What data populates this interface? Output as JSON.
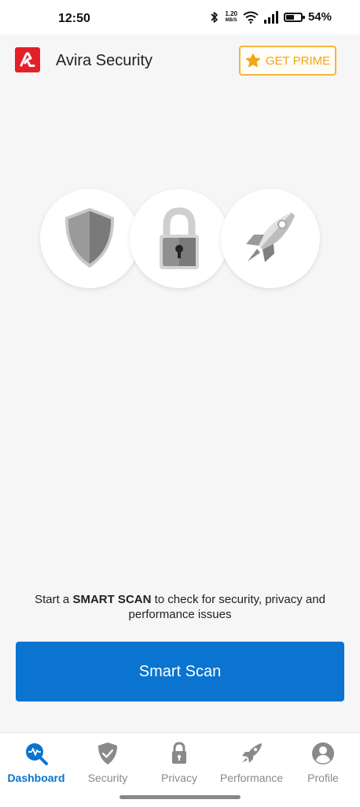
{
  "status_bar": {
    "time": "12:50",
    "net_speed_value": "1.20",
    "net_speed_unit": "MB/S",
    "battery_percent": "54%",
    "battery_level": 0.54,
    "icons": [
      "bluetooth-icon",
      "wifi-icon",
      "signal-icon",
      "battery-icon"
    ]
  },
  "header": {
    "title": "Avira Security",
    "prime_label": "GET PRIME",
    "logo_icon": "avira-logo",
    "prime_icon": "star-icon"
  },
  "illustration": {
    "icons": [
      "shield-icon",
      "padlock-icon",
      "rocket-icon"
    ]
  },
  "scan": {
    "text_prefix": "Start a ",
    "text_bold": "SMART SCAN",
    "text_suffix": " to check for security, privacy and performance issues",
    "button_label": "Smart Scan"
  },
  "nav": {
    "items": [
      {
        "label": "Dashboard",
        "icon": "dashboard-icon",
        "active": true
      },
      {
        "label": "Security",
        "icon": "shield-check-icon",
        "active": false
      },
      {
        "label": "Privacy",
        "icon": "lock-icon",
        "active": false
      },
      {
        "label": "Performance",
        "icon": "rocket-icon",
        "active": false
      },
      {
        "label": "Profile",
        "icon": "person-icon",
        "active": false
      }
    ]
  },
  "colors": {
    "accent": "#0a74d0",
    "brand_red": "#e3202a",
    "prime_orange": "#f2a516",
    "inactive": "#8a8a8a"
  }
}
